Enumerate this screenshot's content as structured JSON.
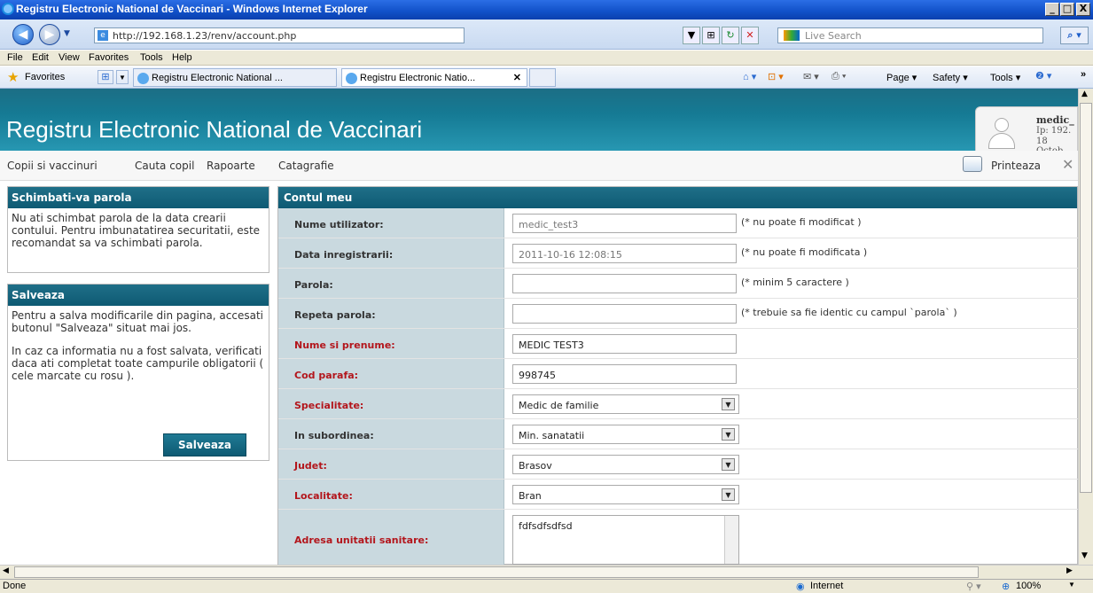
{
  "window": {
    "title": "Registru Electronic National de Vaccinari - Windows Internet Explorer",
    "controls": [
      "_",
      "□",
      "X"
    ]
  },
  "addressbar": {
    "url": "http://192.168.1.23/renv/account.php",
    "search_placeholder": "Live Search"
  },
  "menu": [
    "File",
    "Edit",
    "View",
    "Favorites",
    "Tools",
    "Help"
  ],
  "favorites_bar": {
    "favorites_label": "Favorites",
    "tabs": [
      {
        "label": "Registru Electronic National ...",
        "active": false
      },
      {
        "label": "Registru Electronic Natio...",
        "active": true
      }
    ],
    "tools": [
      "Page ▾",
      "Safety ▾",
      "Tools ▾"
    ]
  },
  "site": {
    "title": "Registru Electronic National de Vaccinari",
    "user": {
      "name": "medic_",
      "ip": "Ip: 192.",
      "date": "18 Octob"
    },
    "nav": [
      "Copii si vaccinuri",
      "Cauta copil",
      "Rapoarte",
      "Catagrafie"
    ],
    "print_label": "Printeaza"
  },
  "left": {
    "panel1": {
      "title": "Schimbati-va parola",
      "text": "Nu ati schimbat parola de la data crearii contului. Pentru imbunatatirea securitatii, este recomandat sa va schimbati parola."
    },
    "panel2": {
      "title": "Salveaza",
      "text1": "Pentru a salva modificarile din pagina, accesati butonul \"Salveaza\" situat mai jos.",
      "text2": "In caz ca informatia nu a fost salvata, verificati daca ati completat toate campurile obligatorii ( cele marcate cu rosu ).",
      "button": "Salveaza"
    }
  },
  "form": {
    "title": "Contul meu",
    "fields": [
      {
        "label": "Nume utilizator:",
        "value": "medic_test3",
        "note": "(* nu poate fi modificat )",
        "required": false
      },
      {
        "label": "Data inregistrarii:",
        "value": "2011-10-16 12:08:15",
        "note": "(* nu poate fi modificata )",
        "required": false
      },
      {
        "label": "Parola:",
        "value": "",
        "note": "(* minim 5 caractere )",
        "required": false
      },
      {
        "label": "Repeta parola:",
        "value": "",
        "note": "(* trebuie sa fie identic cu campul `parola` )",
        "required": false
      },
      {
        "label": "Nume si prenume:",
        "value": "MEDIC TEST3",
        "note": "",
        "required": true
      },
      {
        "label": "Cod parafa:",
        "value": "998745",
        "note": "",
        "required": true
      },
      {
        "label": "Specialitate:",
        "value": "Medic de familie",
        "note": "",
        "required": true
      },
      {
        "label": "In subordinea:",
        "value": "Min. sanatatii",
        "note": "",
        "required": false
      },
      {
        "label": "Judet:",
        "value": "Brasov",
        "note": "",
        "required": true
      },
      {
        "label": "Localitate:",
        "value": "Bran",
        "note": "",
        "required": true
      },
      {
        "label": "Adresa unitatii sanitare:",
        "value": "fdfsdfsdfsd",
        "note": "",
        "required": true
      }
    ]
  },
  "statusbar": {
    "left": "Done",
    "zone": "Internet",
    "zoom": "100%"
  },
  "colors": {
    "header": "#157a94",
    "label_bg": "#c9d9df",
    "required": "#b3161c"
  }
}
